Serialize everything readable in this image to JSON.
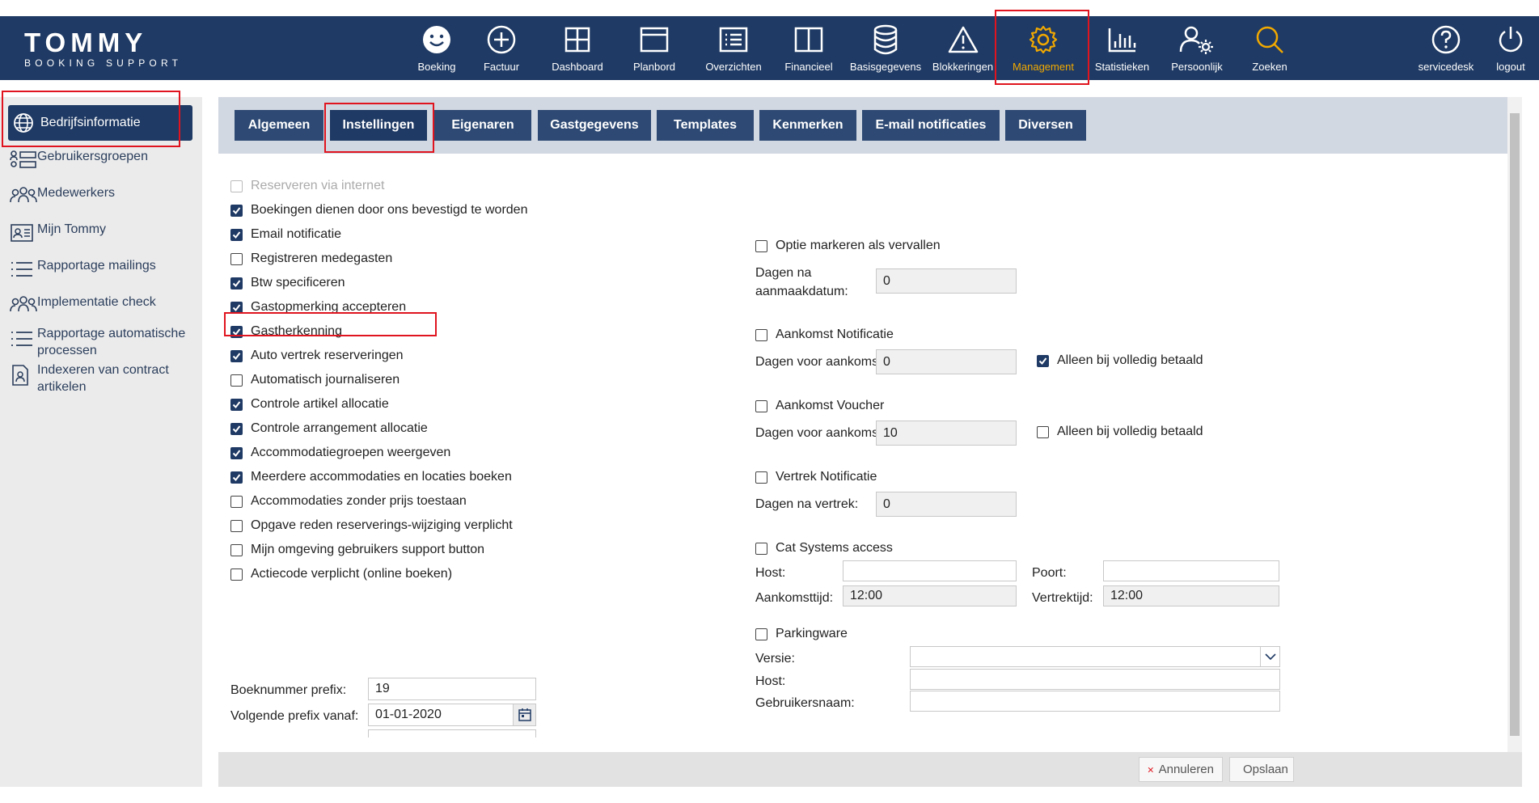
{
  "brand": {
    "name": "TOMMY",
    "tagline": "BOOKING SUPPORT"
  },
  "nav": [
    {
      "label": "Boeking",
      "icon": "smiley-icon"
    },
    {
      "label": "Factuur",
      "icon": "plus-circle-icon"
    },
    {
      "label": "Dashboard",
      "icon": "grid-icon"
    },
    {
      "label": "Planbord",
      "icon": "window-icon"
    },
    {
      "label": "Overzichten",
      "icon": "list-icon"
    },
    {
      "label": "Financieel",
      "icon": "columns-icon"
    },
    {
      "label": "Basisgegevens",
      "icon": "database-icon"
    },
    {
      "label": "Blokkeringen",
      "icon": "warning-icon"
    },
    {
      "label": "Management",
      "icon": "gear-icon"
    },
    {
      "label": "Statistieken",
      "icon": "bar-chart-icon"
    },
    {
      "label": "Persoonlijk",
      "icon": "user-gear-icon"
    },
    {
      "label": "Zoeken",
      "icon": "search-icon"
    },
    {
      "label": "servicedesk",
      "icon": "help-icon"
    },
    {
      "label": "logout",
      "icon": "power-icon"
    }
  ],
  "colors": {
    "nav_bg": "#1f3a64",
    "active_nav": "#f2a900",
    "highlight": "#e0141e"
  },
  "sidebar": [
    {
      "label": "Bedrijfsinformatie",
      "icon": "globe-icon"
    },
    {
      "label": "Gebruikersgroepen",
      "icon": "user-groups-icon"
    },
    {
      "label": "Medewerkers",
      "icon": "people-icon"
    },
    {
      "label": "Mijn Tommy",
      "icon": "id-card-icon"
    },
    {
      "label": "Rapportage mailings",
      "icon": "list-lines-icon"
    },
    {
      "label": "Implementatie check",
      "icon": "people-check-icon"
    },
    {
      "label": "Rapportage automatische processen",
      "icon": "list-lines-icon"
    },
    {
      "label": "Indexeren van contract artikelen",
      "icon": "document-person-icon"
    }
  ],
  "tabs": [
    "Algemeen",
    "Instellingen",
    "Eigenaren",
    "Gastgegevens",
    "Templates",
    "Kenmerken",
    "E-mail notificaties",
    "Diversen"
  ],
  "left_checks": [
    {
      "label": "Reserveren via internet",
      "checked": false,
      "disabled": true
    },
    {
      "label": "Boekingen dienen door ons bevestigd te worden",
      "checked": true
    },
    {
      "label": "Email notificatie",
      "checked": true
    },
    {
      "label": "Registreren medegasten",
      "checked": false
    },
    {
      "label": "Btw specificeren",
      "checked": true
    },
    {
      "label": "Gastopmerking accepteren",
      "checked": true
    },
    {
      "label": "Gastherkenning",
      "checked": true
    },
    {
      "label": "Auto vertrek reserveringen",
      "checked": true
    },
    {
      "label": "Automatisch journaliseren",
      "checked": false
    },
    {
      "label": "Controle artikel allocatie",
      "checked": true
    },
    {
      "label": "Controle arrangement allocatie",
      "checked": true
    },
    {
      "label": "Accommodatiegroepen weergeven",
      "checked": true
    },
    {
      "label": "Meerdere accommodaties en locaties boeken",
      "checked": true
    },
    {
      "label": "Accommodaties zonder prijs toestaan",
      "checked": false
    },
    {
      "label": "Opgave reden reserverings-wijziging verplicht",
      "checked": false
    },
    {
      "label": "Mijn omgeving gebruikers support button",
      "checked": false
    },
    {
      "label": "Actiecode verplicht (online boeken)",
      "checked": false
    }
  ],
  "prefix": {
    "boeknummer_label": "Boeknummer prefix:",
    "boeknummer_value": "19",
    "volgende_label": "Volgende prefix vanaf:",
    "volgende_value": "01-01-2020"
  },
  "right": {
    "optie_markeren": {
      "label": "Optie markeren als vervallen",
      "checked": false
    },
    "dagen_na_aanmaak_label1": "Dagen na",
    "dagen_na_aanmaak_label2": "aanmaakdatum:",
    "dagen_na_aanmaak_value": "0",
    "aankomst_notificatie": {
      "label": "Aankomst Notificatie",
      "checked": false
    },
    "aankomst_notif_dagen_label": "Dagen voor aankomst:",
    "aankomst_notif_dagen_value": "0",
    "aankomst_notif_betaald": {
      "label": "Alleen bij volledig betaald",
      "checked": true
    },
    "aankomst_voucher": {
      "label": "Aankomst Voucher",
      "checked": false
    },
    "aankomst_voucher_dagen_label": "Dagen voor aankomst:",
    "aankomst_voucher_dagen_value": "10",
    "aankomst_voucher_betaald": {
      "label": "Alleen bij volledig betaald",
      "checked": false
    },
    "vertrek_notificatie": {
      "label": "Vertrek Notificatie",
      "checked": false
    },
    "vertrek_dagen_label": "Dagen na vertrek:",
    "vertrek_dagen_value": "0",
    "cat_systems": {
      "label": "Cat Systems access",
      "checked": false
    },
    "host_label": "Host:",
    "host_value": "",
    "poort_label": "Poort:",
    "poort_value": "",
    "aankomsttijd_label": "Aankomsttijd:",
    "aankomsttijd_value": "12:00",
    "vertrektijd_label": "Vertrektijd:",
    "vertrektijd_value": "12:00",
    "parkingware": {
      "label": "Parkingware",
      "checked": false
    },
    "versie_label": "Versie:",
    "versie_value": "",
    "pw_host_label": "Host:",
    "pw_host_value": "",
    "gebruikersnaam_label": "Gebruikersnaam:",
    "gebruikersnaam_value": ""
  },
  "buttons": {
    "annuleren": "Annuleren",
    "opslaan": "Opslaan"
  }
}
